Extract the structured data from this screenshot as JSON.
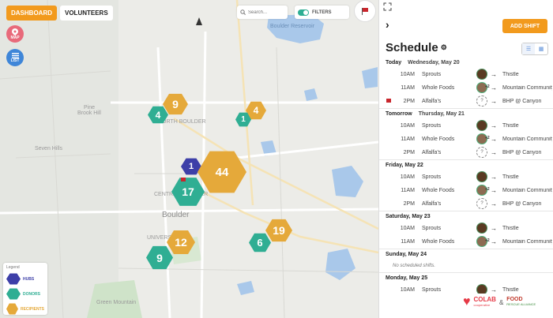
{
  "nav": {
    "dashboard": "DASHBOARD",
    "volunteers": "VOLUNTEERS"
  },
  "map_buttons": {
    "map": "MAP",
    "list": "LIST"
  },
  "search": {
    "placeholder": "Search..."
  },
  "filters": {
    "label": "FILTERS",
    "on": true
  },
  "map_labels": {
    "boulder": "Boulder",
    "pine_brook": "Pine Brook Hill",
    "seven_hills": "Seven Hills",
    "green_mountain": "Green Mountain",
    "boulder_reservoir": "Boulder Reservoir",
    "north_boulder": "NORTH BOULDER",
    "central_boulder": "CENTRAL BOULDER",
    "university": "UNIVERSITY"
  },
  "clusters": [
    {
      "kind": "recip",
      "count": "9"
    },
    {
      "kind": "donor",
      "count": "4"
    },
    {
      "kind": "recip",
      "count": "4"
    },
    {
      "kind": "donor",
      "count": "1"
    },
    {
      "kind": "hub",
      "count": "1"
    },
    {
      "kind": "recip",
      "count": "44"
    },
    {
      "kind": "donor",
      "count": "17"
    },
    {
      "kind": "recip",
      "count": "19"
    },
    {
      "kind": "donor",
      "count": "6"
    },
    {
      "kind": "recip",
      "count": "12"
    },
    {
      "kind": "donor",
      "count": "9"
    }
  ],
  "legend": {
    "title": "Legend",
    "items": [
      {
        "label": "HUBS",
        "color": "#3d3fa8"
      },
      {
        "label": "DONORS",
        "color": "#2fae93"
      },
      {
        "label": "RECIPIENTS",
        "color": "#e5a93a"
      }
    ]
  },
  "panel": {
    "add_shift": "ADD SHIFT",
    "title": "Schedule",
    "days": [
      {
        "label": "Today",
        "date": "Wednesday, May 20",
        "shifts": [
          {
            "time": "10AM",
            "donor": "Sprouts",
            "volunteer": "assigned",
            "count": "",
            "recipient": "Thistle",
            "flag": false
          },
          {
            "time": "11AM",
            "donor": "Whole Foods",
            "volunteer": "assigned",
            "count": "+2",
            "recipient": "Mountain Community",
            "flag": false
          },
          {
            "time": "2PM",
            "donor": "Alfalfa's",
            "volunteer": "unassigned",
            "count": "",
            "recipient": "BHP @ Canyon",
            "flag": true
          }
        ]
      },
      {
        "label": "Tomorrow",
        "date": "Thursday, May 21",
        "shifts": [
          {
            "time": "10AM",
            "donor": "Sprouts",
            "volunteer": "assigned",
            "count": "",
            "recipient": "Thistle",
            "flag": false
          },
          {
            "time": "11AM",
            "donor": "Whole Foods",
            "volunteer": "assigned",
            "count": "+2",
            "recipient": "Mountain Community",
            "flag": false
          },
          {
            "time": "2PM",
            "donor": "Alfalfa's",
            "volunteer": "unassigned",
            "count": "",
            "recipient": "BHP @ Canyon",
            "flag": false
          }
        ]
      },
      {
        "label": "Friday, May 22",
        "date": "",
        "shifts": [
          {
            "time": "10AM",
            "donor": "Sprouts",
            "volunteer": "assigned",
            "count": "",
            "recipient": "Thistle",
            "flag": false
          },
          {
            "time": "11AM",
            "donor": "Whole Foods",
            "volunteer": "assigned",
            "count": "+2",
            "recipient": "Mountain Community",
            "flag": false
          },
          {
            "time": "2PM",
            "donor": "Alfalfa's",
            "volunteer": "unassigned",
            "count": "",
            "recipient": "BHP @ Canyon",
            "flag": false
          }
        ]
      },
      {
        "label": "Saturday, May 23",
        "date": "",
        "shifts": [
          {
            "time": "10AM",
            "donor": "Sprouts",
            "volunteer": "assigned",
            "count": "",
            "recipient": "Thistle",
            "flag": false
          },
          {
            "time": "11AM",
            "donor": "Whole Foods",
            "volunteer": "assigned",
            "count": "+2",
            "recipient": "Mountain Community",
            "flag": false
          }
        ]
      },
      {
        "label": "Sunday, May 24",
        "date": "",
        "empty": "No scheduled shifts.",
        "shifts": []
      },
      {
        "label": "Monday, May 25",
        "date": "",
        "shifts": [
          {
            "time": "10AM",
            "donor": "Sprouts",
            "volunteer": "assigned",
            "count": "",
            "recipient": "Thistle",
            "flag": false
          }
        ]
      }
    ]
  },
  "logos": {
    "colab": "COLAB",
    "colab_sub": "cooperative",
    "amp": "&",
    "food": "FOOD",
    "food_sub": "RESCUE ALLIANCE"
  }
}
